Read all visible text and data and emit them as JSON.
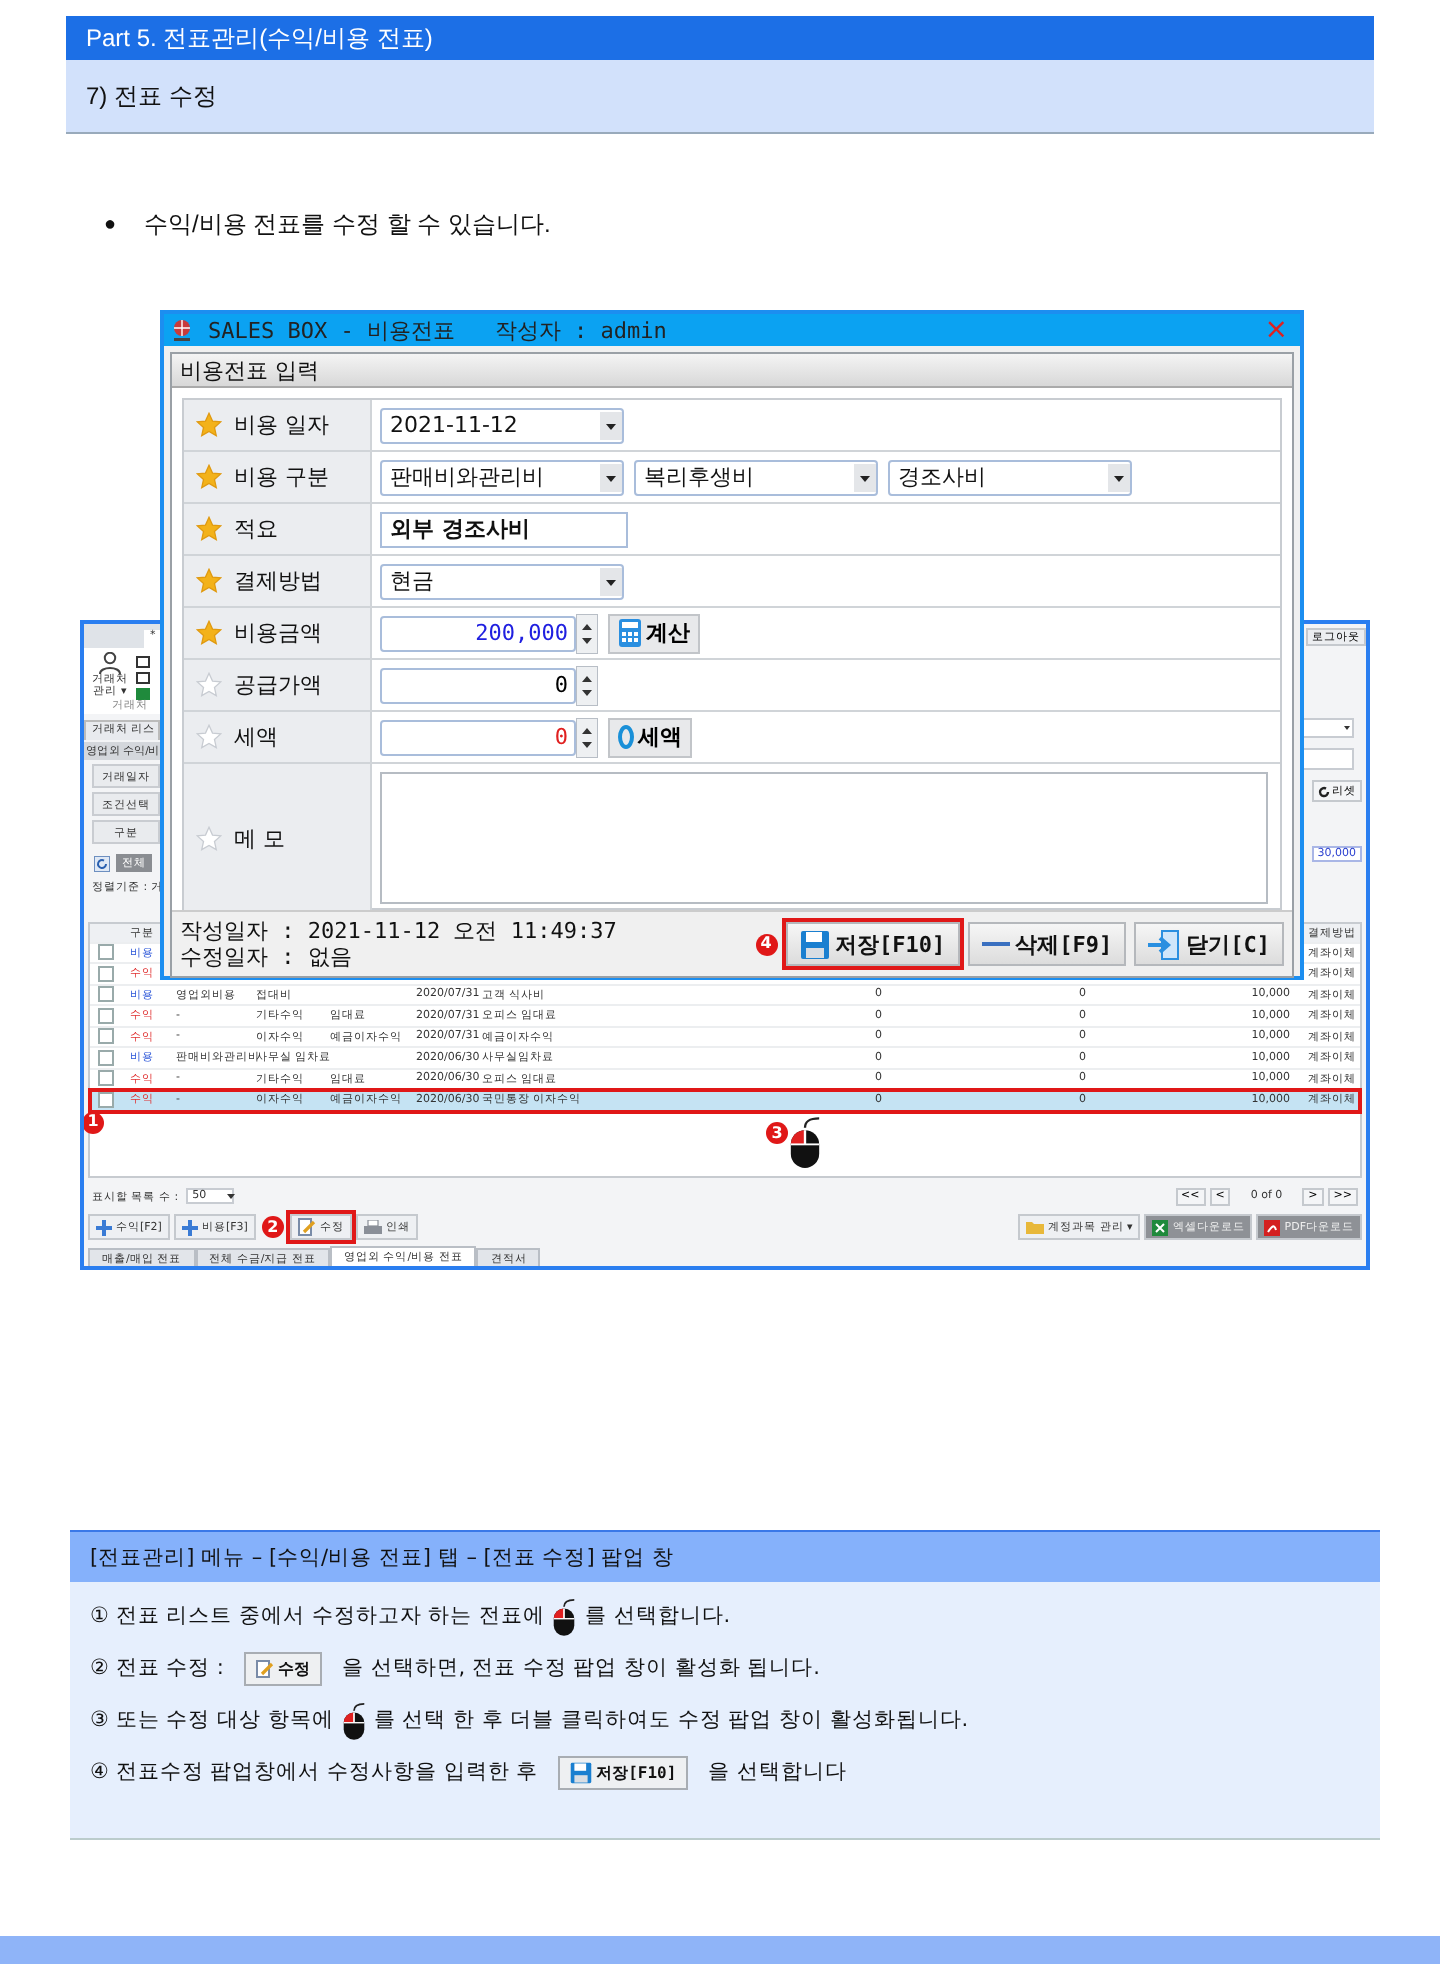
{
  "doc_header": {
    "part_title": "Part 5. 전표관리(수익/비용 전표)",
    "section_title": "7) 전표 수정"
  },
  "bullet": {
    "marker": "●",
    "text": "수익/비용 전표를 수정 할 수 있습니다."
  },
  "app_window": {
    "top_tab": "*",
    "logout": "로그아웃",
    "ribbon_button": "거래처 관리 ▾",
    "ribbon_group": "거래처",
    "list_tab": "거래처 리스",
    "panel_title": "영업외 수익/비",
    "filters": [
      "거래일자",
      "조건선택",
      "구분"
    ],
    "all_button": "전체",
    "sort_label": "정렬기준 : 거",
    "reset_button": "리셋",
    "total": "30,000",
    "columns": [
      "구분",
      "결제방법"
    ],
    "rows": [
      {
        "type": "비용",
        "kind": "expense",
        "payment": "계좌이체",
        "selected": false
      },
      {
        "type": "수익",
        "kind": "income",
        "payment": "계좌이체",
        "selected": false
      },
      {
        "type": "비용",
        "kind": "expense",
        "account": "영업외비용",
        "item": "접대비",
        "date": "2020/07/31",
        "memo": "고객 식사비",
        "supply": "0",
        "tax": "0",
        "amount": "10,000",
        "payment": "계좌이체",
        "selected": false
      },
      {
        "type": "수익",
        "kind": "income",
        "account": "-",
        "item": "기타수익",
        "detail": "임대료",
        "date": "2020/07/31",
        "memo": "오피스 임대료",
        "supply": "0",
        "tax": "0",
        "amount": "10,000",
        "payment": "계좌이체",
        "selected": false
      },
      {
        "type": "수익",
        "kind": "income",
        "account": "-",
        "item": "이자수익",
        "detail": "예금이자수익",
        "date": "2020/07/31",
        "memo": "예금이자수익",
        "supply": "0",
        "tax": "0",
        "amount": "10,000",
        "payment": "계좌이체",
        "selected": false
      },
      {
        "type": "비용",
        "kind": "expense",
        "account": "판매비와관리비",
        "item": "사무실 임차료",
        "date": "2020/06/30",
        "memo": "사무실임차료",
        "supply": "0",
        "tax": "0",
        "amount": "10,000",
        "payment": "계좌이체",
        "selected": false
      },
      {
        "type": "수익",
        "kind": "income",
        "account": "-",
        "item": "기타수익",
        "detail": "임대료",
        "date": "2020/06/30",
        "memo": "오피스 임대료",
        "supply": "0",
        "tax": "0",
        "amount": "10,000",
        "payment": "계좌이체",
        "selected": false
      },
      {
        "type": "수익",
        "kind": "income",
        "account": "-",
        "item": "이자수익",
        "detail": "예금이자수익",
        "date": "2020/06/30",
        "memo": "국민통장 이자수익",
        "supply": "0",
        "tax": "0",
        "amount": "10,000",
        "payment": "계좌이체",
        "selected": true,
        "badge": "1"
      }
    ],
    "mouse_marker": {
      "badge": "3"
    },
    "page_size_label": "표시할 목록 수 :",
    "page_size": "50",
    "pager": {
      "first": "<<",
      "prev": "<",
      "info": "0 of 0",
      "next": ">",
      "last": ">>"
    },
    "actions": [
      {
        "label": "수익[F2]",
        "kind": "plus"
      },
      {
        "label": "비용[F3]",
        "kind": "plus"
      },
      {
        "label": "수정",
        "kind": "edit",
        "badge": "2"
      },
      {
        "label": "인쇄",
        "kind": "print"
      }
    ],
    "right_actions": [
      {
        "label": "계정과목 관리 ▾",
        "kind": "folder"
      },
      {
        "label": "엑셀다운로드",
        "kind": "excel"
      },
      {
        "label": "PDF다운로드",
        "kind": "pdf"
      }
    ],
    "bottom_tabs": [
      {
        "label": "매출/매입 전표",
        "selected": false
      },
      {
        "label": "전체 수금/지급 전표",
        "selected": false
      },
      {
        "label": "영업외 수익/비용 전표",
        "selected": true
      },
      {
        "label": "견적서",
        "selected": false
      }
    ]
  },
  "popup": {
    "title": "SALES BOX - 비용전표   작성자 : admin",
    "close": "×",
    "panel_title": "비용전표 입력",
    "fields": [
      {
        "label": "비용 일자",
        "required": true,
        "kind": "select",
        "values": [
          "2021-11-12"
        ]
      },
      {
        "label": "비용 구분",
        "required": true,
        "kind": "select",
        "values": [
          "판매비와관리비",
          "복리후생비",
          "경조사비"
        ]
      },
      {
        "label": "적요",
        "required": true,
        "kind": "text",
        "value": "외부 경조사비"
      },
      {
        "label": "결제방법",
        "required": true,
        "kind": "select",
        "values": [
          "현금"
        ]
      },
      {
        "label": "비용금액",
        "required": true,
        "kind": "number",
        "value": "200,000",
        "color": "#2020e0",
        "button": {
          "label": "계산",
          "kind": "calculator"
        }
      },
      {
        "label": "공급가액",
        "required": false,
        "kind": "number",
        "value": "0",
        "color": "#000000"
      },
      {
        "label": "세액",
        "required": false,
        "kind": "number",
        "value": "0",
        "color": "#e02020",
        "button": {
          "label": "세액",
          "kind": "zero"
        }
      },
      {
        "label": "메 모",
        "required": false,
        "kind": "memo"
      }
    ],
    "created": "작성일자 : 2021-11-12 오전 11:49:37",
    "modified": "수정일자 : 없음",
    "buttons": [
      {
        "label": "저장[F10]",
        "kind": "save",
        "badge": "4"
      },
      {
        "label": "삭제[F9]",
        "kind": "minus"
      },
      {
        "label": "닫기[C]",
        "kind": "exit"
      }
    ]
  },
  "note": {
    "title": "[전표관리] 메뉴 – [수익/비용 전표] 탭 – [전표 수정] 팝업 창",
    "lines": [
      [
        {
          "kind": "text",
          "text": "①  전표 리스트 중에서 수정하고자 하는 전표에"
        },
        {
          "kind": "mouse"
        },
        {
          "kind": "text",
          "text": "를 선택합니다."
        }
      ],
      [
        {
          "kind": "text",
          "text": "②  전표 수정 :"
        },
        {
          "kind": "edit_button",
          "text": "수정"
        },
        {
          "kind": "text",
          "text": "을 선택하면, 전표 수정 팝업 창이 활성화 됩니다."
        }
      ],
      [
        {
          "kind": "text",
          "text": "③  또는 수정 대상 항목에"
        },
        {
          "kind": "mouse"
        },
        {
          "kind": "text",
          "text": "를 선택 한 후 더블 클릭하여도 수정 팝업 창이 활성화됩니다."
        }
      ],
      [
        {
          "kind": "text",
          "text": "④ 전표수정 팝업창에서  수정사항을 입력한 후"
        },
        {
          "kind": "save_button",
          "text": "저장[F10]"
        },
        {
          "kind": "text",
          "text": "을 선택합니다"
        }
      ]
    ]
  }
}
